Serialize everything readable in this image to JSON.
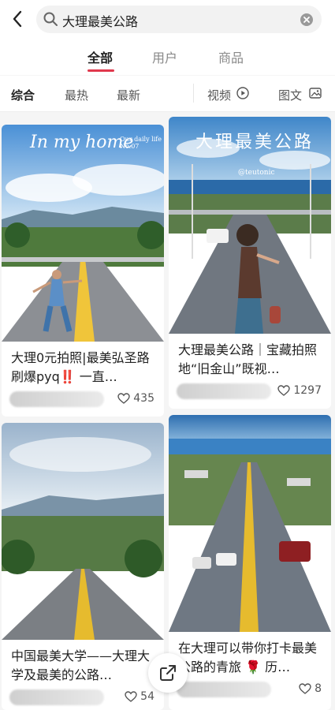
{
  "search": {
    "query": "大理最美公路"
  },
  "tabs": [
    {
      "label": "全部"
    },
    {
      "label": "用户"
    },
    {
      "label": "商品"
    }
  ],
  "filters": {
    "comprehensive": "综合",
    "hottest": "最热",
    "newest": "最新",
    "video": "视频",
    "image_text": "图文"
  },
  "cards": [
    {
      "title": "大理0元拍照|最美弘圣路 刷爆pyq‼️ 一直…",
      "likes": "435",
      "cover_text": "In my home",
      "cover_sub": "Our daily life  No.07"
    },
    {
      "title": "大理最美公路｜宝藏拍照地“旧金山”既视…",
      "likes": "1297",
      "cover_text": "大理最美公路",
      "cover_sub": "@teutonic"
    },
    {
      "title": "中国最美大学——大理大学及最美的公路…",
      "likes": "54"
    },
    {
      "title": "在大理可以带你打卡最美公路的青旅 🌹 历…",
      "likes": "8"
    }
  ],
  "colors": {
    "accent": "#e0384c",
    "sky": "#6aa7d8",
    "road": "#7a7f86"
  }
}
